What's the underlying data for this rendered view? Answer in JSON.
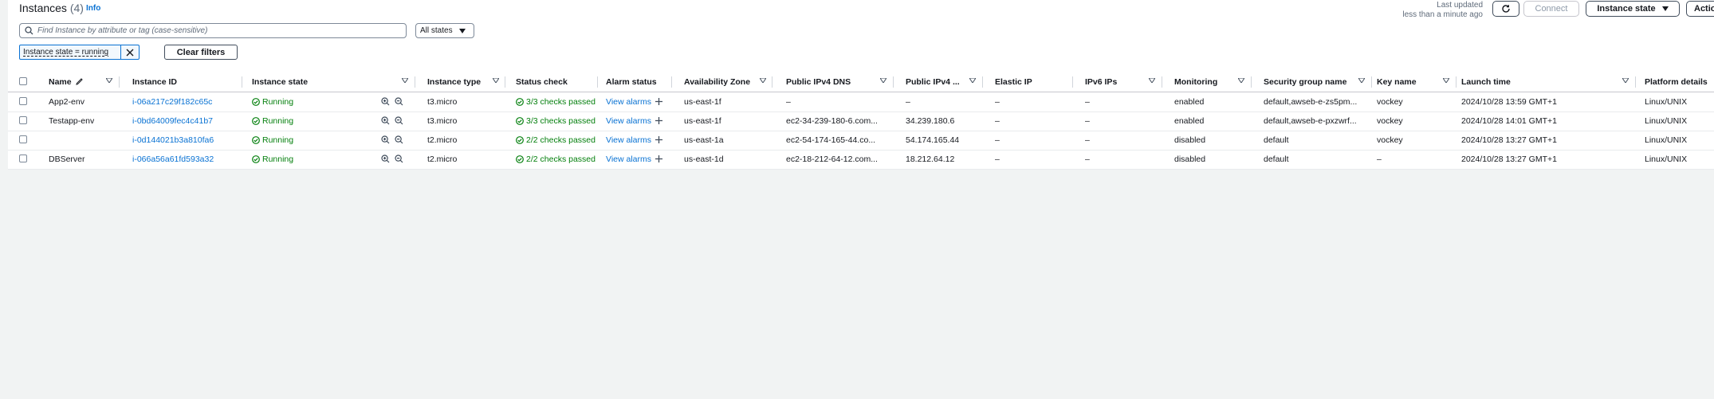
{
  "header": {
    "title": "Instances",
    "count": "(4)",
    "info": "Info",
    "last_updated_label": "Last updated",
    "last_updated_value": "less than a minute ago",
    "connect_label": "Connect",
    "instance_state_label": "Instance state",
    "actions_label": "Actions"
  },
  "search": {
    "placeholder": "Find Instance by attribute or tag (case-sensitive)",
    "states_select": "All states"
  },
  "filters": {
    "token": "Instance state = running",
    "clear_label": "Clear filters"
  },
  "columns": {
    "name": "Name",
    "instance_id": "Instance ID",
    "instance_state": "Instance state",
    "instance_type": "Instance type",
    "status_check": "Status check",
    "alarm_status": "Alarm status",
    "az": "Availability Zone",
    "dns": "Public IPv4 DNS",
    "ipv4": "Public IPv4 ...",
    "eip": "Elastic IP",
    "ipv6": "IPv6 IPs",
    "monitoring": "Monitoring",
    "sg": "Security group name",
    "key": "Key name",
    "launch": "Launch time",
    "platform": "Platform details"
  },
  "rows": [
    {
      "name": "App2-env",
      "id": "i-06a217c29f182c65c",
      "state": "Running",
      "type": "t3.micro",
      "status": "3/3 checks passed",
      "alarm": "View alarms",
      "az": "us-east-1f",
      "dns": "–",
      "ipv4": "–",
      "eip": "–",
      "ipv6": "–",
      "monitoring": "enabled",
      "sg": "default,awseb-e-zs5pm...",
      "key": "vockey",
      "launch": "2024/10/28 13:59 GMT+1",
      "platform": "Linux/UNIX"
    },
    {
      "name": "Testapp-env",
      "id": "i-0bd64009fec4c41b7",
      "state": "Running",
      "type": "t3.micro",
      "status": "3/3 checks passed",
      "alarm": "View alarms",
      "az": "us-east-1f",
      "dns": "ec2-34-239-180-6.com...",
      "ipv4": "34.239.180.6",
      "eip": "–",
      "ipv6": "–",
      "monitoring": "enabled",
      "sg": "default,awseb-e-pxzwrf...",
      "key": "vockey",
      "launch": "2024/10/28 14:01 GMT+1",
      "platform": "Linux/UNIX"
    },
    {
      "name": "",
      "id": "i-0d144021b3a810fa6",
      "state": "Running",
      "type": "t2.micro",
      "status": "2/2 checks passed",
      "alarm": "View alarms",
      "az": "us-east-1a",
      "dns": "ec2-54-174-165-44.co...",
      "ipv4": "54.174.165.44",
      "eip": "–",
      "ipv6": "–",
      "monitoring": "disabled",
      "sg": "default",
      "key": "vockey",
      "launch": "2024/10/28 13:27 GMT+1",
      "platform": "Linux/UNIX"
    },
    {
      "name": "DBServer",
      "id": "i-066a56a61fd593a32",
      "state": "Running",
      "type": "t2.micro",
      "status": "2/2 checks passed",
      "alarm": "View alarms",
      "az": "us-east-1d",
      "dns": "ec2-18-212-64-12.com...",
      "ipv4": "18.212.64.12",
      "eip": "–",
      "ipv6": "–",
      "monitoring": "disabled",
      "sg": "default",
      "key": "–",
      "launch": "2024/10/28 13:27 GMT+1",
      "platform": "Linux/UNIX"
    }
  ],
  "colors": {
    "link": "#0972d3",
    "success": "#037f0c",
    "text": "#16191f",
    "background": "#f1f3f3"
  }
}
